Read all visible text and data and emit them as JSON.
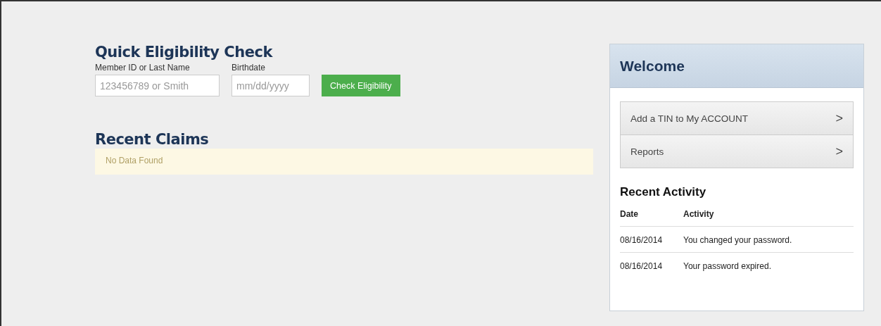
{
  "eligibility": {
    "title": "Quick Eligibility Check",
    "member_label": "Member ID or Last Name",
    "member_placeholder": "123456789 or Smith",
    "birthdate_label": "Birthdate",
    "birthdate_placeholder": "mm/dd/yyyy",
    "button": "Check Eligibility"
  },
  "recent_claims": {
    "title": "Recent Claims",
    "message": "No Data Found"
  },
  "welcome": {
    "title": "Welcome",
    "links": [
      {
        "label": "Add a TIN to My ACCOUNT",
        "arrow": ">"
      },
      {
        "label": "Reports",
        "arrow": ">"
      }
    ]
  },
  "recent_activity": {
    "title": "Recent Activity",
    "columns": [
      "Date",
      "Activity"
    ],
    "rows": [
      [
        "08/16/2014",
        "You changed your password."
      ],
      [
        "08/16/2014",
        "Your password expired."
      ]
    ]
  }
}
